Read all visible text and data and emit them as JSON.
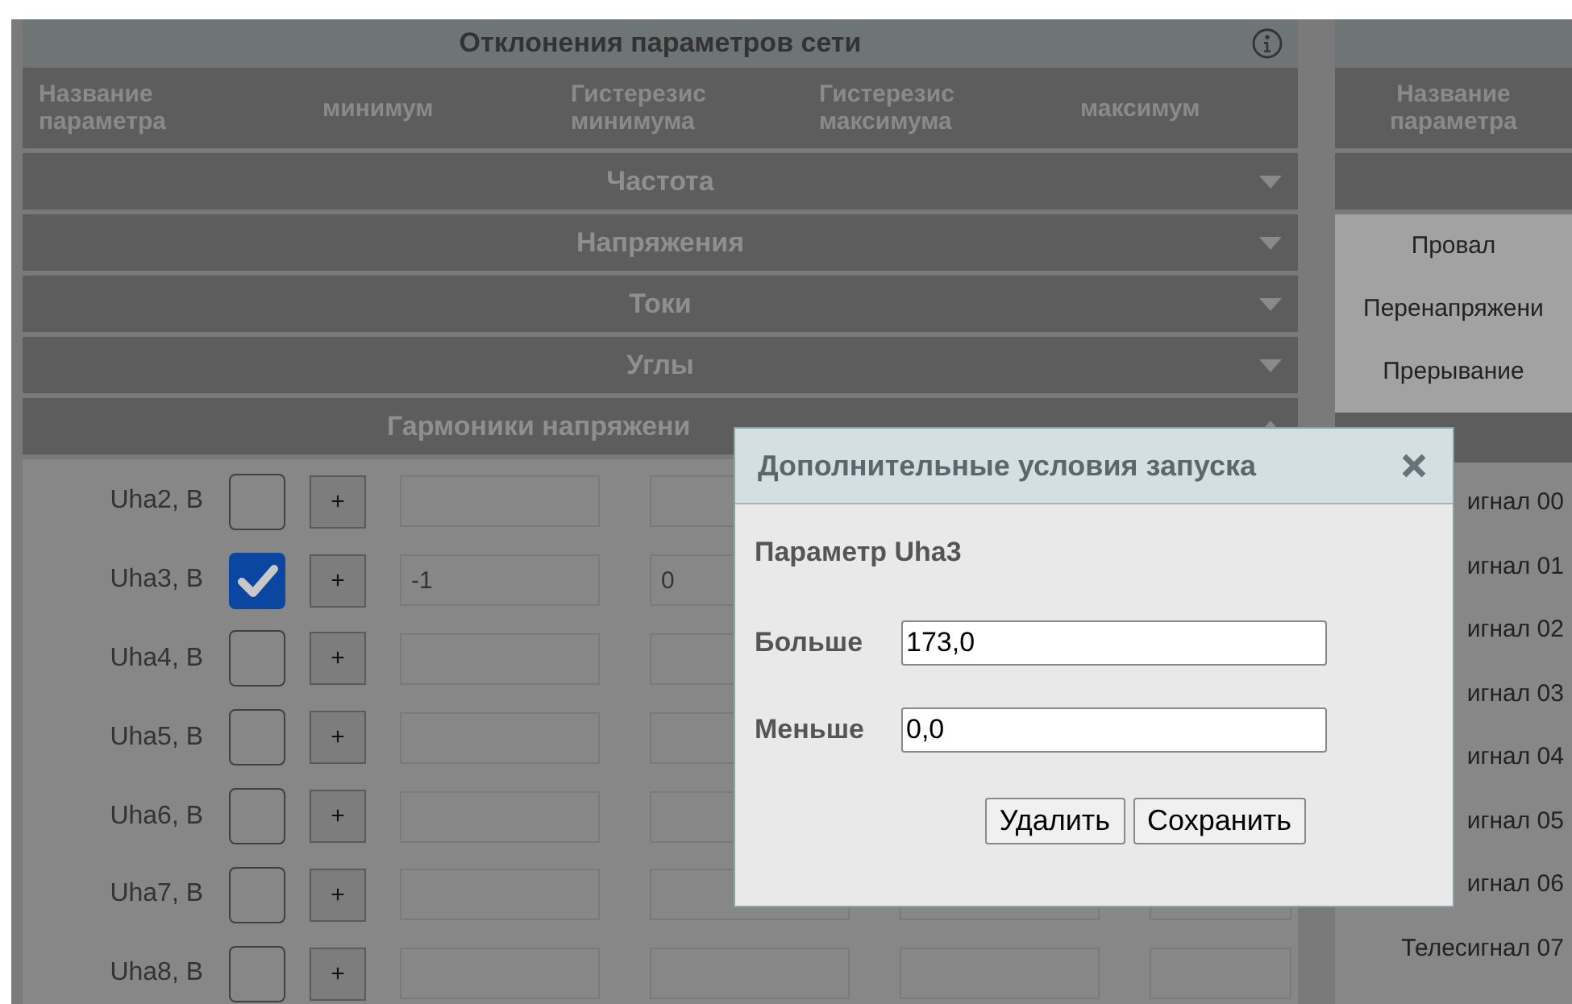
{
  "left_panel": {
    "title": "Отклонения параметров сети",
    "columns": [
      "Название параметра",
      "минимум",
      "Гистерезис минимума",
      "Гистерезис максимума",
      "максимум"
    ],
    "groups": [
      {
        "label": "Частота",
        "expanded": false
      },
      {
        "label": "Напряжения",
        "expanded": false
      },
      {
        "label": "Токи",
        "expanded": false
      },
      {
        "label": "Углы",
        "expanded": false
      },
      {
        "label": "Гармоники напряжени",
        "expanded": true
      }
    ],
    "rows": [
      {
        "name": "Uha2, В",
        "checked": false,
        "values": []
      },
      {
        "name": "Uha3, В",
        "checked": true,
        "values": [
          "-1",
          "0"
        ]
      },
      {
        "name": "Uha4, В",
        "checked": false,
        "values": []
      },
      {
        "name": "Uha5, В",
        "checked": false,
        "values": []
      },
      {
        "name": "Uha6, В",
        "checked": false,
        "values": []
      },
      {
        "name": "Uha7, В",
        "checked": false,
        "values": []
      },
      {
        "name": "Uha8, В",
        "checked": false,
        "values": []
      }
    ],
    "add_button": "+"
  },
  "right_panel": {
    "columns": [
      "Название параметра"
    ],
    "events": [
      "Провал",
      "Перенапряжени",
      "Прерывание"
    ],
    "signals": [
      "игнал 00",
      "игнал 01",
      "игнал 02",
      "игнал 03",
      "игнал 04",
      "игнал 05",
      "игнал 06",
      "Телесигнал 07"
    ]
  },
  "dialog": {
    "title": "Дополнительные условия запуска",
    "parameter": "Параметр Uha3",
    "fields": [
      {
        "label": "Больше",
        "value": "173,0"
      },
      {
        "label": "Меньше",
        "value": "0,0"
      }
    ],
    "buttons": [
      "Удалить",
      "Сохранить"
    ]
  }
}
